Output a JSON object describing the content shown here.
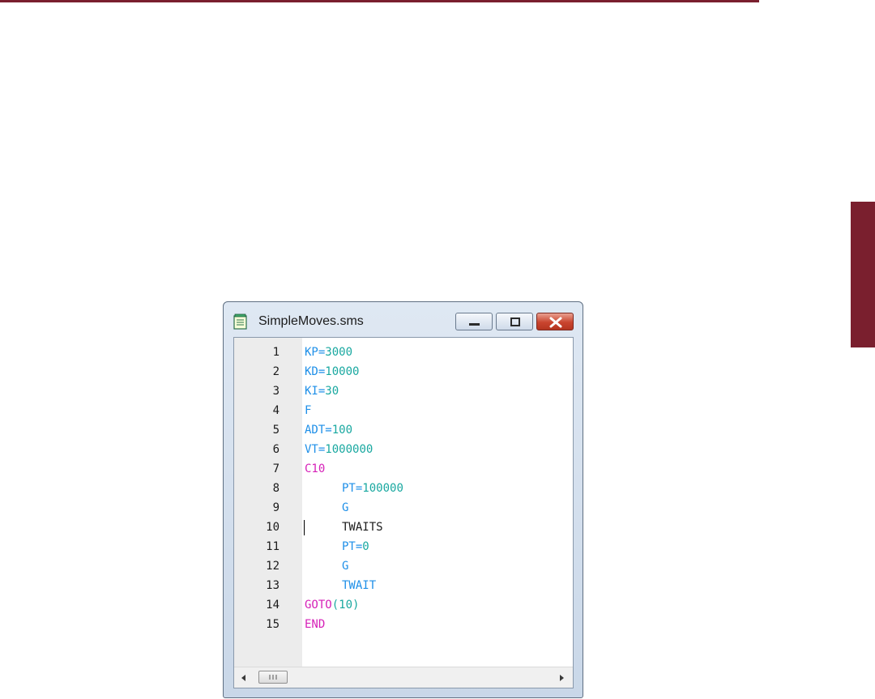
{
  "window": {
    "title": "SimpleMoves.sms",
    "buttons": [
      "minimize",
      "maximize",
      "close"
    ]
  },
  "editor": {
    "caret_line": 10,
    "lines": [
      {
        "num": "1",
        "indent": false,
        "tokens": [
          {
            "t": "KP",
            "c": "kw"
          },
          {
            "t": "=",
            "c": "op"
          },
          {
            "t": "3000",
            "c": "val"
          }
        ]
      },
      {
        "num": "2",
        "indent": false,
        "tokens": [
          {
            "t": "KD",
            "c": "kw"
          },
          {
            "t": "=",
            "c": "op"
          },
          {
            "t": "10000",
            "c": "val"
          }
        ]
      },
      {
        "num": "3",
        "indent": false,
        "tokens": [
          {
            "t": "KI",
            "c": "kw"
          },
          {
            "t": "=",
            "c": "op"
          },
          {
            "t": "30",
            "c": "val"
          }
        ]
      },
      {
        "num": "4",
        "indent": false,
        "tokens": [
          {
            "t": "F",
            "c": "kw"
          }
        ]
      },
      {
        "num": "5",
        "indent": false,
        "tokens": [
          {
            "t": "ADT",
            "c": "kw"
          },
          {
            "t": "=",
            "c": "op"
          },
          {
            "t": "100",
            "c": "val"
          }
        ]
      },
      {
        "num": "6",
        "indent": false,
        "tokens": [
          {
            "t": "VT",
            "c": "kw"
          },
          {
            "t": "=",
            "c": "op"
          },
          {
            "t": "1000000",
            "c": "val"
          }
        ]
      },
      {
        "num": "7",
        "indent": false,
        "tokens": [
          {
            "t": "C10",
            "c": "ctl"
          }
        ]
      },
      {
        "num": "8",
        "indent": true,
        "tokens": [
          {
            "t": "PT",
            "c": "kw"
          },
          {
            "t": "=",
            "c": "op"
          },
          {
            "t": "100000",
            "c": "val"
          }
        ]
      },
      {
        "num": "9",
        "indent": true,
        "tokens": [
          {
            "t": "G",
            "c": "kw"
          }
        ]
      },
      {
        "num": "10",
        "indent": true,
        "tokens": [
          {
            "t": "TWAITS",
            "c": "plain"
          }
        ]
      },
      {
        "num": "11",
        "indent": true,
        "tokens": [
          {
            "t": "PT",
            "c": "kw"
          },
          {
            "t": "=",
            "c": "op"
          },
          {
            "t": "0",
            "c": "val"
          }
        ]
      },
      {
        "num": "12",
        "indent": true,
        "tokens": [
          {
            "t": "G",
            "c": "kw"
          }
        ]
      },
      {
        "num": "13",
        "indent": true,
        "tokens": [
          {
            "t": "TWAIT",
            "c": "kw"
          }
        ]
      },
      {
        "num": "14",
        "indent": false,
        "tokens": [
          {
            "t": "GOTO",
            "c": "ctl"
          },
          {
            "t": "(10)",
            "c": "val"
          }
        ]
      },
      {
        "num": "15",
        "indent": false,
        "tokens": [
          {
            "t": "END",
            "c": "ctl"
          }
        ]
      }
    ]
  },
  "scrollbar": {
    "thumb_glyph": "III"
  },
  "colors": {
    "accent": "#7a1f2e",
    "keyword": "#1e8fe8",
    "control": "#d621b8",
    "value": "#19a8a0",
    "gutter": "#ececec"
  }
}
